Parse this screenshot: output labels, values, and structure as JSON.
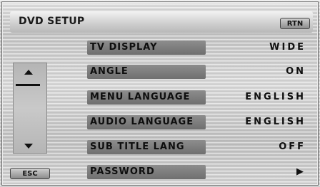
{
  "header": {
    "title": "DVD SETUP",
    "rtn_label": "RTN"
  },
  "footer": {
    "esc_label": "ESC"
  },
  "menu": {
    "items": [
      {
        "label": "TV DISPLAY",
        "value": "WIDE"
      },
      {
        "label": "ANGLE",
        "value": "ON"
      },
      {
        "label": "MENU LANGUAGE",
        "value": "ENGLISH"
      },
      {
        "label": "AUDIO LANGUAGE",
        "value": "ENGLISH"
      },
      {
        "label": "SUB TITLE LANG",
        "value": "OFF"
      },
      {
        "label": "PASSWORD",
        "value": "▶"
      }
    ]
  },
  "scrollbar": {
    "up_icon": "triangle-up",
    "down_icon": "triangle-down"
  }
}
